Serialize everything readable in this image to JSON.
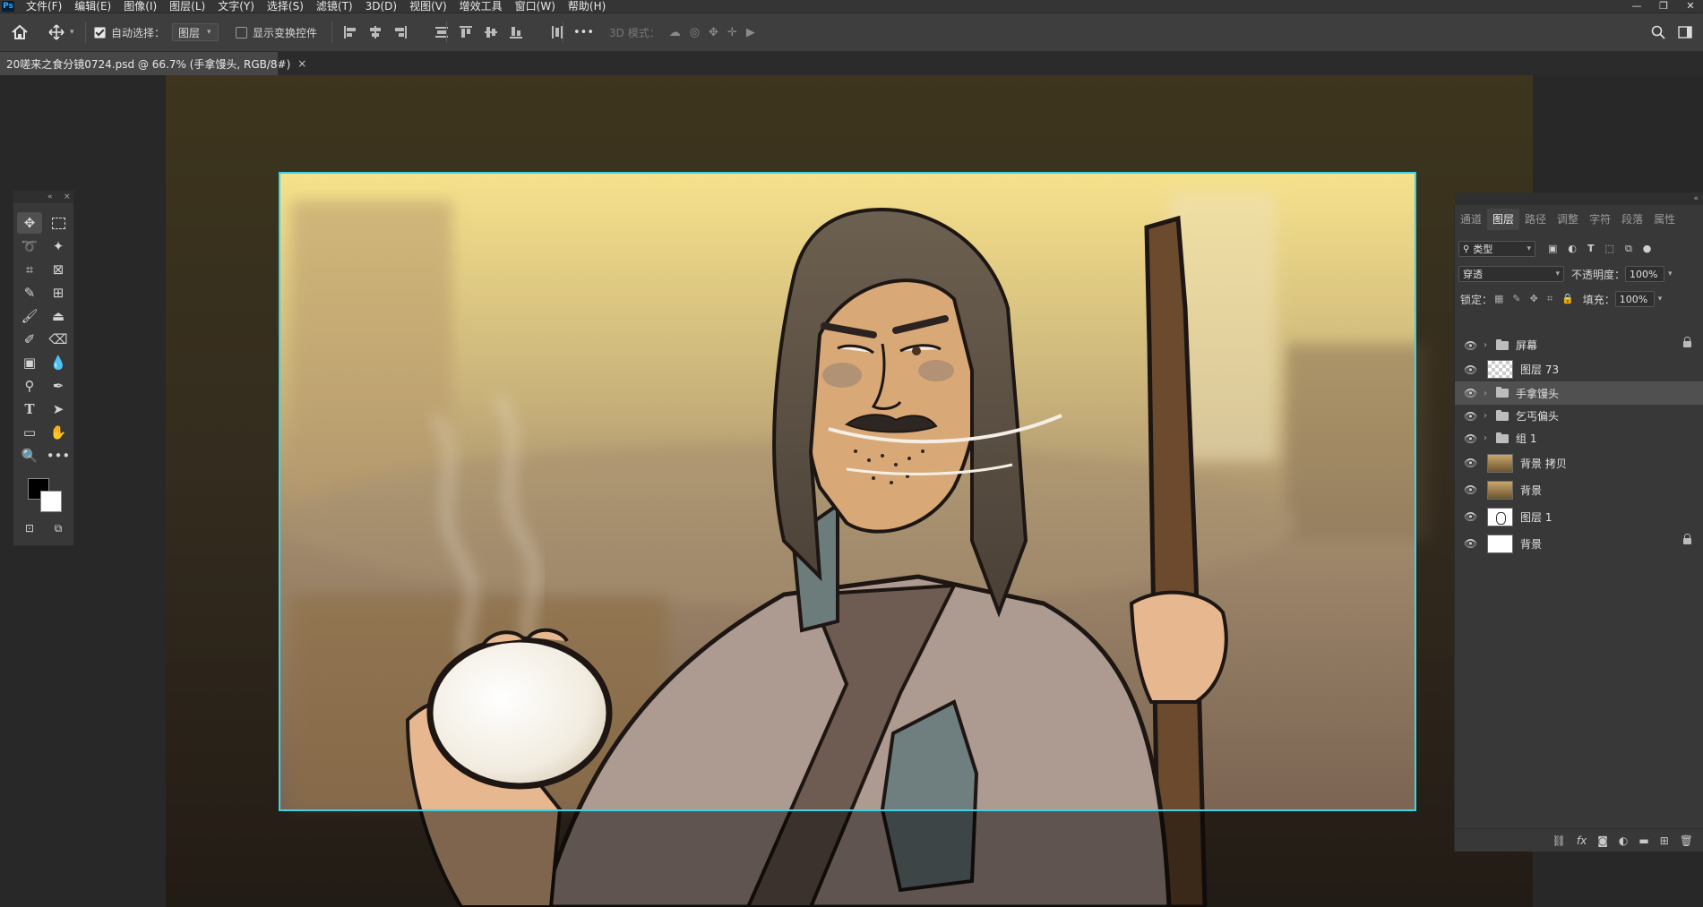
{
  "menubar": {
    "logo": "Ps",
    "items": [
      "文件(F)",
      "编辑(E)",
      "图像(I)",
      "图层(L)",
      "文字(Y)",
      "选择(S)",
      "滤镜(T)",
      "3D(D)",
      "视图(V)",
      "增效工具",
      "窗口(W)",
      "帮助(H)"
    ]
  },
  "window_controls": {
    "minimize": "—",
    "restore": "❐",
    "close": "✕"
  },
  "optionsbar": {
    "home_icon": "home-icon",
    "move_icon": "move-tool-icon",
    "auto_select_label": "自动选择：",
    "auto_select_checked": true,
    "auto_select_target": "图层",
    "show_transform_label": "显示变换控件",
    "show_transform_checked": false,
    "more_label": "•••",
    "mode3d_label": "3D 模式："
  },
  "document": {
    "tab_title": "20嗟来之食分镜0724.psd @ 66.7% (手拿馒头, RGB/8#)",
    "close": "×"
  },
  "toolbox": {
    "collapse": "«",
    "close": "×",
    "foreground_color": "#000000",
    "background_color": "#ffffff"
  },
  "panel": {
    "tabs": [
      "通道",
      "图层",
      "路径",
      "调整",
      "字符",
      "段落",
      "属性"
    ],
    "active_tab": "图层",
    "filter_kind": "类型",
    "blend_mode": "穿透",
    "opacity_label": "不透明度：",
    "opacity_value": "100%",
    "lock_label": "锁定：",
    "fill_label": "填充：",
    "fill_value": "100%",
    "layers": [
      {
        "name": "屏幕",
        "type": "group",
        "locked": true
      },
      {
        "name": "图层 73",
        "type": "layer",
        "thumb": "checker"
      },
      {
        "name": "手拿馒头",
        "type": "group",
        "selected": true
      },
      {
        "name": "乞丐偏头",
        "type": "group"
      },
      {
        "name": "组 1",
        "type": "group"
      },
      {
        "name": "背景 拷贝",
        "type": "layer",
        "thumb": "photo"
      },
      {
        "name": "背景",
        "type": "layer",
        "thumb": "photo"
      },
      {
        "name": "图层 1",
        "type": "layer",
        "thumb": "sketch"
      },
      {
        "name": "背景",
        "type": "layer",
        "thumb": "white",
        "locked": true
      }
    ],
    "bottom_icons": [
      "link-icon",
      "fx-icon",
      "mask-icon",
      "adjustment-icon",
      "new-group-icon",
      "new-layer-icon",
      "trash-icon"
    ]
  },
  "colors": {
    "frame": "#3fd2e6",
    "panel_bg": "#383838",
    "app_bg": "#282828"
  }
}
